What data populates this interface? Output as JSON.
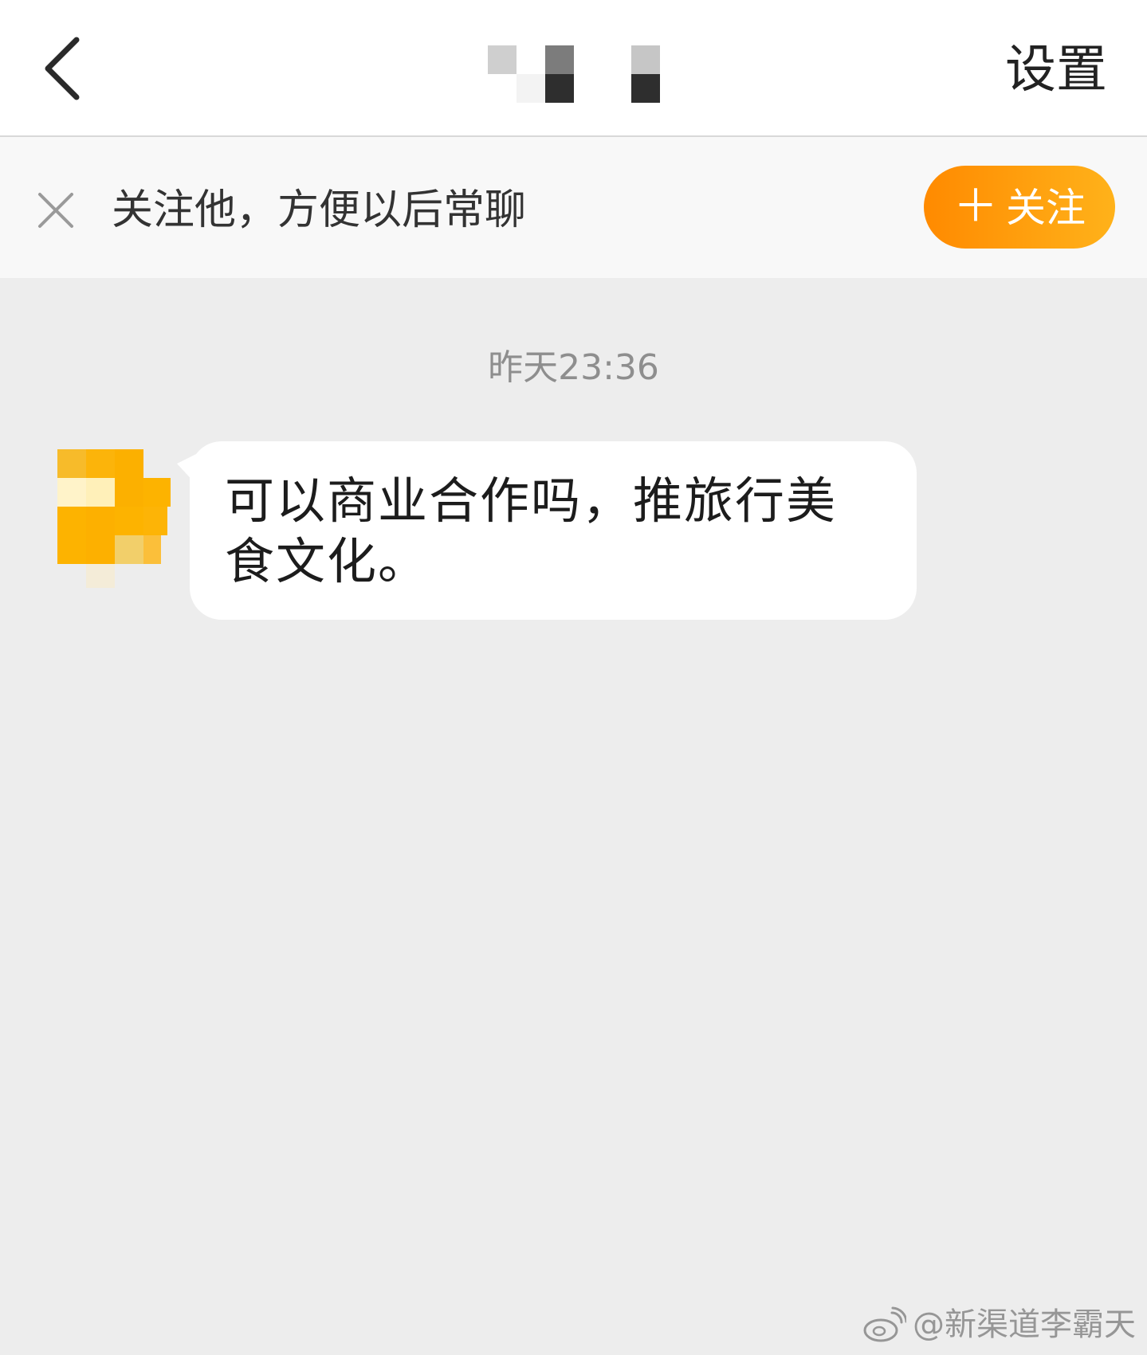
{
  "header": {
    "settings_label": "设置"
  },
  "follow_bar": {
    "hint": "关注他，方便以后常聊",
    "button_plus": "＋",
    "button_label": "关注"
  },
  "chat": {
    "timestamp": "昨天23:36",
    "messages": [
      {
        "text": "可以商业合作吗，推旅行美食文化。"
      }
    ]
  },
  "watermark": {
    "text": "@新渠道李霸天"
  },
  "colors": {
    "accent_start": "#ff8a00",
    "accent_end": "#ffb21a",
    "chat_background": "#ededed"
  }
}
